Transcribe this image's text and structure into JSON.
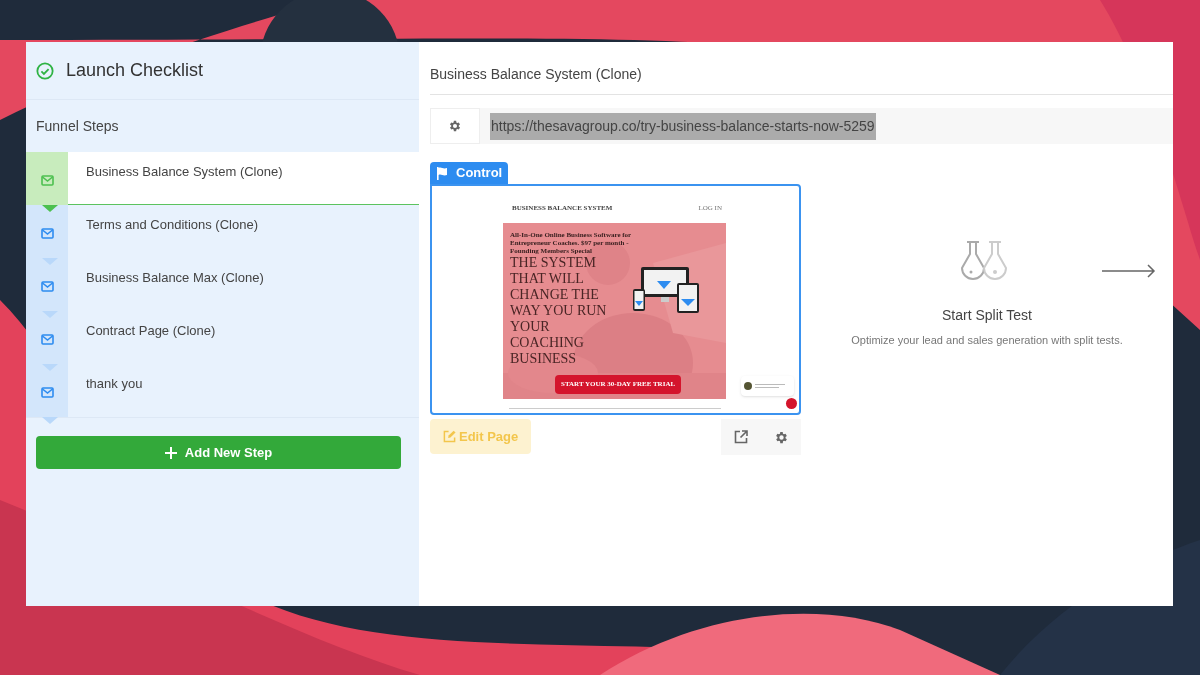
{
  "sidebar": {
    "title": "Launch Checklist",
    "section_label": "Funnel Steps",
    "steps": [
      {
        "name": "Business Balance System (Clone)",
        "selected": true
      },
      {
        "name": "Terms and Conditions (Clone)",
        "selected": false
      },
      {
        "name": "Business Balance Max (Clone)",
        "selected": false
      },
      {
        "name": "Contract Page (Clone)",
        "selected": false
      },
      {
        "name": "thank you",
        "selected": false
      }
    ],
    "add_button": "Add New Step"
  },
  "main": {
    "title": "Business Balance System (Clone)",
    "url": {
      "value": "https://thesavagroup.co/try-business-balance-starts-now-5259",
      "selected": true
    },
    "variant": {
      "label": "Control",
      "preview": {
        "brand": "BUSINESS BALANCE SYSTEM",
        "nav_link": "LOG IN",
        "tagline": "All-In-One Online Business Software for Entrepreneur Coaches. $97 per month - Founding Members Special",
        "headline": "THE SYSTEM THAT WILL CHANGE THE WAY YOU RUN YOUR COACHING BUSINESS",
        "cta": "START YOUR 30-DAY FREE TRIAL"
      },
      "edit_button": "Edit Page"
    },
    "split_test": {
      "title": "Start Split Test",
      "description": "Optimize your lead and sales generation with split tests."
    }
  }
}
